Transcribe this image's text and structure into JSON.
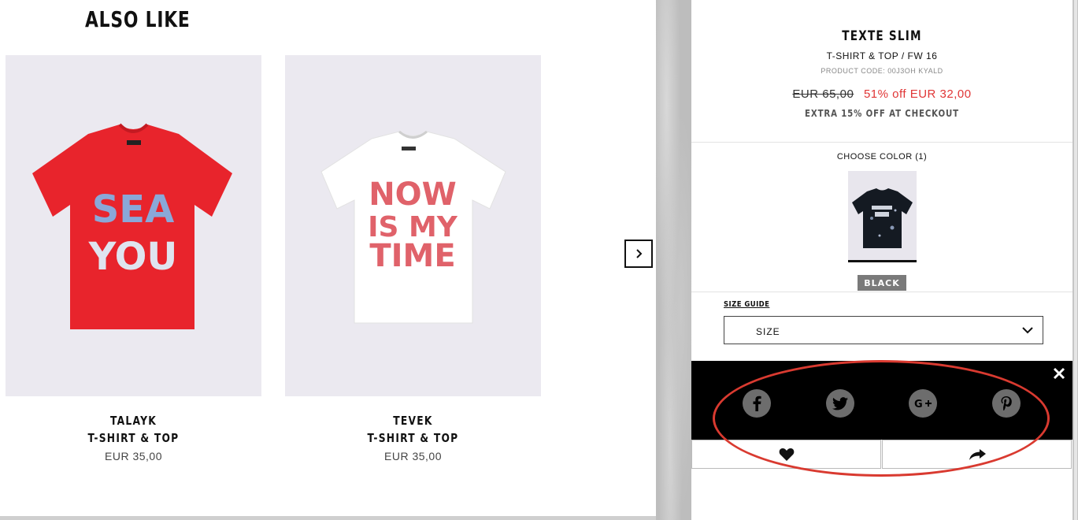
{
  "recommendations": {
    "title": "ALSO LIKE",
    "items": [
      {
        "name": "TALAYK",
        "type": "T-SHIRT & TOP",
        "price": "EUR 35,00",
        "shirt_color": "#e8242c",
        "print_line1": "SEA",
        "print_line2": "YOU"
      },
      {
        "name": "TEVEK",
        "type": "T-SHIRT & TOP",
        "price": "EUR 35,00",
        "shirt_color": "#ffffff",
        "print_line1": "NOW",
        "print_line2": "IS MY",
        "print_line3": "TIME"
      }
    ],
    "next_icon": "chevron-right-icon"
  },
  "product": {
    "title": "TEXTE SLIM",
    "category": "T-SHIRT & TOP / FW 16",
    "code": "PRODUCT CODE: 00J3OH KYALD",
    "old_price": "EUR 65,00",
    "sale_price": "51% off EUR 32,00",
    "extra_offer": "EXTRA 15% OFF AT CHECKOUT",
    "choose_color_label": "CHOOSE COLOR (1)",
    "selected_color": "BLACK",
    "size_guide_label": "SIZE GUIDE",
    "size_placeholder": "SIZE"
  },
  "share": {
    "close_icon": "close-icon",
    "networks": [
      "facebook",
      "twitter",
      "google-plus",
      "pinterest"
    ]
  },
  "actions": {
    "wishlist_icon": "heart-icon",
    "share_icon": "share-arrow-icon"
  },
  "colors": {
    "sale_red": "#e03535",
    "highlight_red": "#d93a30",
    "share_bar": "#000000",
    "social_circle": "#6d6d6d"
  }
}
